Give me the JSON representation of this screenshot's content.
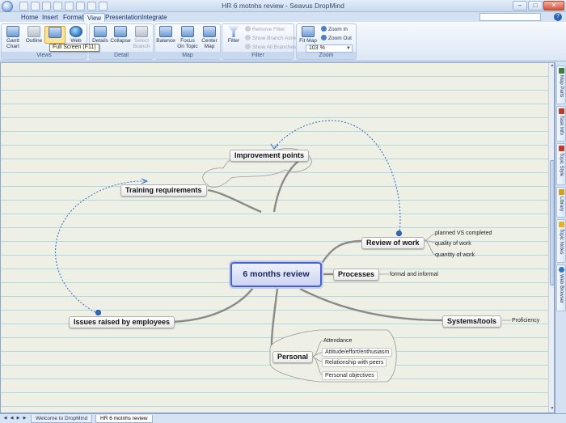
{
  "window": {
    "title": "HR 6 motnhs review - Seavus DropMind",
    "minimize": "–",
    "maximize": "□",
    "close": "✕"
  },
  "ribbon_tabs": [
    "Home",
    "Insert",
    "Format",
    "View",
    "Presentation",
    "Integrate"
  ],
  "active_tab": "View",
  "help": "?",
  "ribbon": {
    "views": {
      "label": "Views",
      "gantt": "Gantt Chart",
      "outline": "Outline",
      "full_screen": "Full Screen",
      "web": "Web"
    },
    "detail": {
      "label": "Detail",
      "details": "Details",
      "collapse": "Collapse",
      "select_branch": "Select Branch"
    },
    "map": {
      "label": "Map",
      "balance": "Balance",
      "focus_on_topic": "Focus On Topic",
      "center_map": "Center Map"
    },
    "filter": {
      "label": "Filter",
      "filter": "Filter",
      "remove_filter": "Remove Filter",
      "show_branch_alone": "Show Branch Alone",
      "show_all_branches": "Show All Branches"
    },
    "zoom": {
      "label": "Zoom",
      "fit_map": "Fit Map",
      "zoom_in": "Zoom In",
      "zoom_out": "Zoom Out",
      "level": "103 %"
    }
  },
  "tooltip": "Full Screen (F11)",
  "map": {
    "central": "6 months review",
    "topics": {
      "improvement": "Improvement points",
      "training": "Training requirements",
      "review": "Review of work",
      "processes": "Processes",
      "issues": "Issues raised by employees",
      "systems": "Systems/tools",
      "personal": "Personal"
    },
    "review_children": [
      "planned VS completed",
      "quality of work",
      "quantity of work"
    ],
    "processes_child": "formal and informal",
    "systems_child": "Proficiency",
    "personal_children": [
      "Attendance",
      "Attitude/effort/enthusiasm",
      "Relationship with peers",
      "Personal objectives"
    ]
  },
  "side_tabs": [
    "Map Parts",
    "Task Info",
    "Topic Style",
    "Library",
    "Topic Notes",
    "Web Browser"
  ],
  "doc_tabs": [
    "Welcome to DropMind",
    "HR 6 motnhs review"
  ],
  "active_doc_tab": "HR 6 motnhs review",
  "colors": {
    "central_border": "#4b63c5",
    "relationship_line": "#2c69c8",
    "branch_line": "#8a8a8a",
    "canvas_bg": "#eef0e5",
    "canvas_lines": "#b7d7df"
  }
}
